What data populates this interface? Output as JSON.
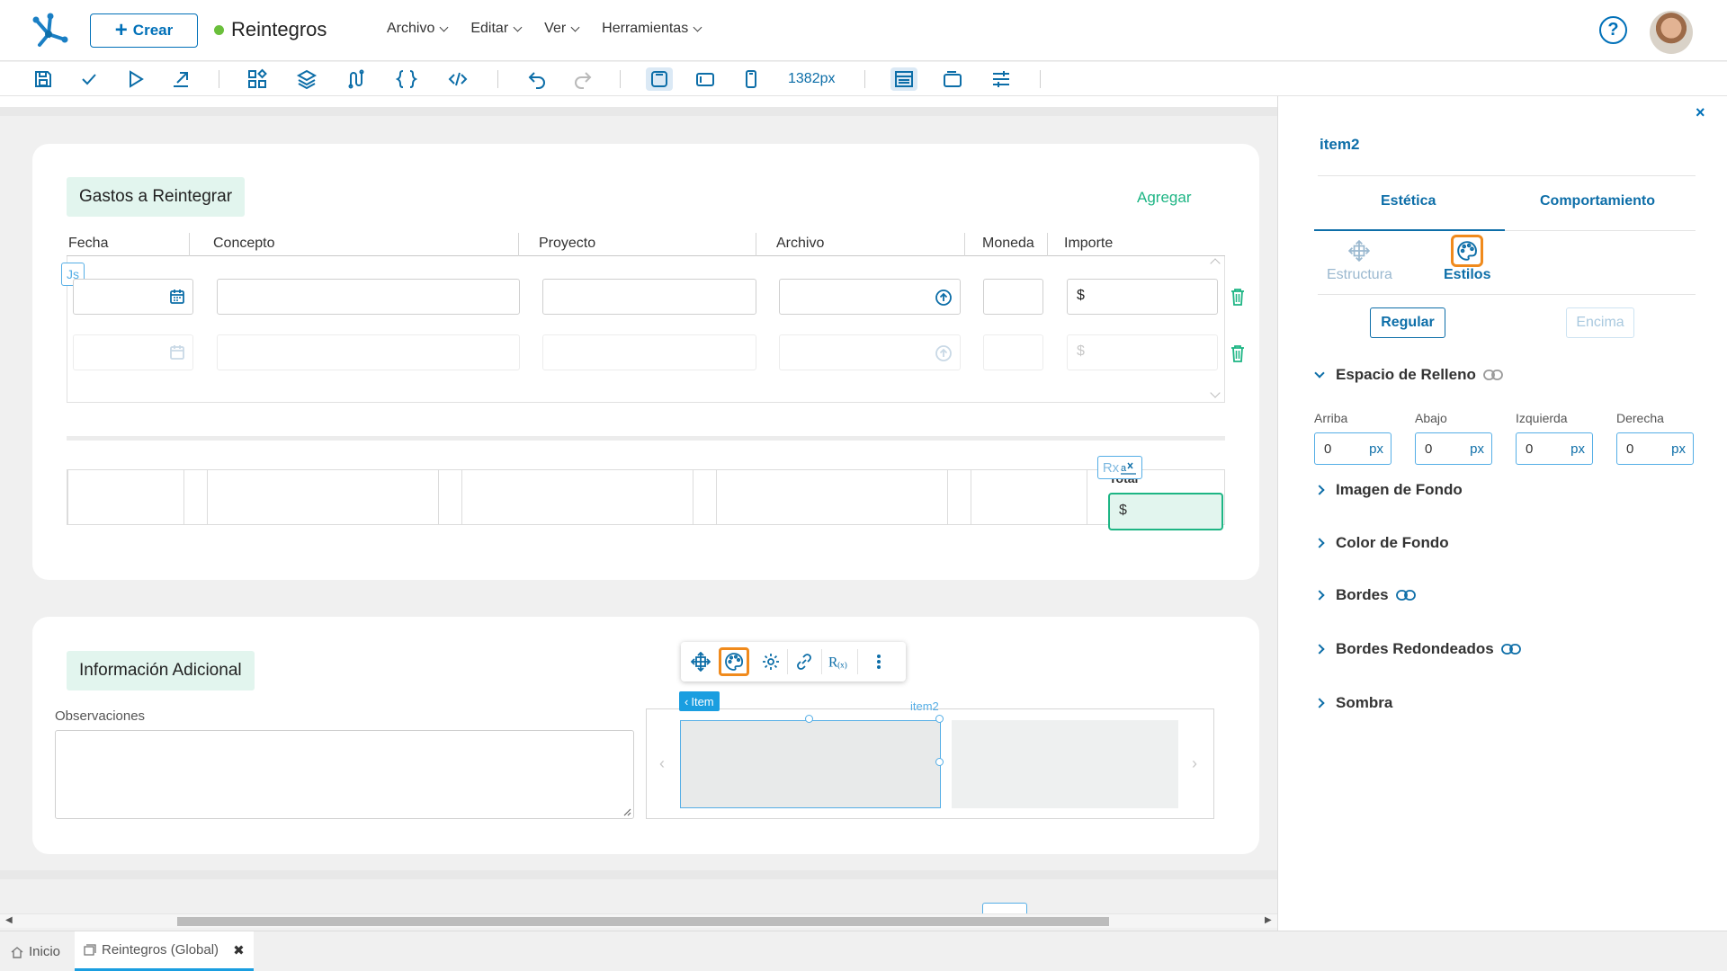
{
  "header": {
    "create_label": "Crear",
    "doc_title": "Reintegros",
    "menu": [
      "Archivo",
      "Editar",
      "Ver",
      "Herramientas"
    ],
    "help_label": "?"
  },
  "toolbar": {
    "width_label": "1382px"
  },
  "expenses": {
    "title": "Gastos a Reintegrar",
    "add_label": "Agregar",
    "columns": [
      "Fecha",
      "Concepto",
      "Proyecto",
      "Archivo",
      "Moneda",
      "Importe"
    ],
    "currency_symbol": "$",
    "js_badge": "Js",
    "total_label": "Total",
    "rx_badge": "Rx"
  },
  "additional": {
    "title": "Información Adicional",
    "observations_label": "Observaciones",
    "item_tag": "Item",
    "item2_tag": "item2"
  },
  "panel": {
    "close_label": "×",
    "title": "item2",
    "tabs": [
      "Estética",
      "Comportamiento"
    ],
    "subtabs": [
      "Estructura",
      "Estilos"
    ],
    "modes": [
      "Regular",
      "Encima"
    ],
    "padding_section": "Espacio de Relleno",
    "padding_fields": [
      {
        "label": "Arriba",
        "value": "0",
        "unit": "px"
      },
      {
        "label": "Abajo",
        "value": "0",
        "unit": "px"
      },
      {
        "label": "Izquierda",
        "value": "0",
        "unit": "px"
      },
      {
        "label": "Derecha",
        "value": "0",
        "unit": "px"
      }
    ],
    "sections": [
      "Imagen de Fondo",
      "Color de Fondo",
      "Bordes",
      "Bordes Redondeados",
      "Sombra"
    ]
  },
  "bottom_tabs": {
    "home": "Inicio",
    "current": "Reintegros (Global)"
  },
  "colors": {
    "primary": "#0d6ea8",
    "accent_green": "#1db584",
    "highlight_orange": "#f08a1c",
    "status_dot": "#6abf3b"
  }
}
